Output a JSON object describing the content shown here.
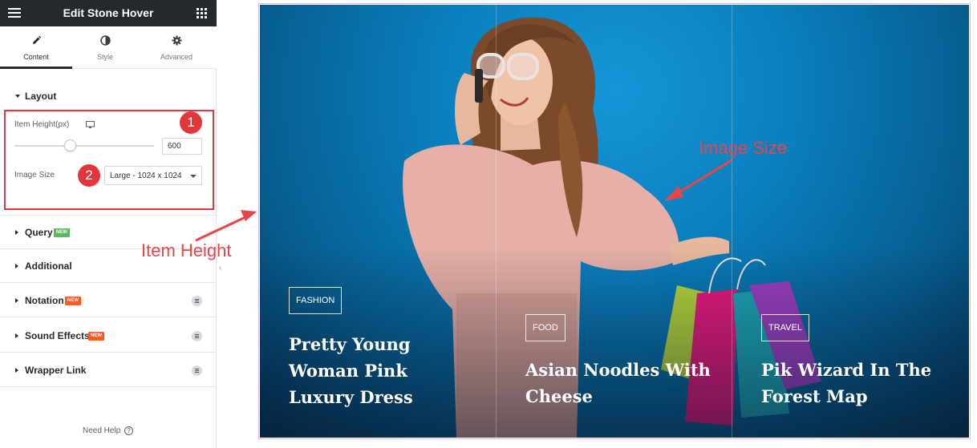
{
  "panel": {
    "title": "Edit Stone Hover",
    "tabs": [
      {
        "label": "Content",
        "icon": "pencil-icon"
      },
      {
        "label": "Style",
        "icon": "contrast-icon"
      },
      {
        "label": "Advanced",
        "icon": "gear-icon"
      }
    ],
    "layout": {
      "title": "Layout",
      "item_height_label": "Item Height(px)",
      "item_height_value": "600",
      "slider_level": 0.36,
      "image_size_label": "Image Size",
      "image_size_value": "Large - 1024 x 1024"
    },
    "sections": [
      {
        "title": "Query",
        "badge": "NEW",
        "badge_color": "#5cb85c",
        "pro": false
      },
      {
        "title": "Additional",
        "badge": "",
        "pro": false
      },
      {
        "title": "Notation",
        "badge": "NEW",
        "badge_color": "#ff5a1f",
        "pro": true
      },
      {
        "title": "Sound Effects",
        "badge": "NEW",
        "badge_color": "#ff5a1f",
        "pro": true
      },
      {
        "title": "Wrapper Link",
        "badge": "",
        "pro": true
      }
    ],
    "need_help": "Need Help",
    "help_icon": "?"
  },
  "markers": [
    "1",
    "2"
  ],
  "annotations": {
    "image_size": "Image Size",
    "item_height": "Item Height"
  },
  "posts": [
    {
      "category": "FASHION",
      "title_lines": [
        "Pretty Young",
        "Woman Pink",
        "Luxury Dress"
      ]
    },
    {
      "category": "FOOD",
      "title_lines": [
        "Asian Noodles With",
        "Cheese"
      ]
    },
    {
      "category": "TRAVEL",
      "title_lines": [
        "Pik Wizard In The",
        "Forest Map"
      ]
    }
  ],
  "colors": {
    "accent": "#e2363d",
    "topbar": "#26292c",
    "hero_blue": "#0a7fbe"
  }
}
